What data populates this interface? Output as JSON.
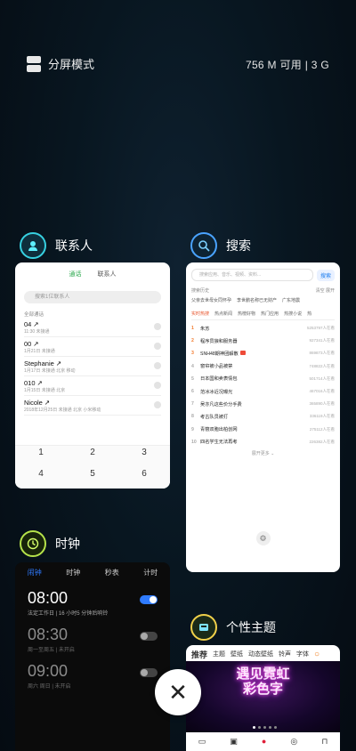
{
  "top": {
    "split_label": "分屏模式",
    "memory": "756 M 可用 | 3 G"
  },
  "contacts": {
    "name": "联系人",
    "tabs": [
      "通话",
      "联系人"
    ],
    "search_placeholder": "搜索1位联系人",
    "section": "全部通话",
    "rows": [
      {
        "name": "04 ↗",
        "detail": "11:30 未接通"
      },
      {
        "name": "00 ↗",
        "detail": "1月21日 未接通"
      },
      {
        "name": "Stephanie ↗",
        "detail": "1月17日 未接通 北京 移动"
      },
      {
        "name": "010 ↗",
        "detail": "1月15日 未接通 北京"
      },
      {
        "name": "Nicole ↗",
        "detail": "2018年12月25日 未接通 北京 小米移动"
      }
    ],
    "keys": [
      "1",
      "2",
      "3",
      "4",
      "5",
      "6"
    ]
  },
  "search": {
    "name": "搜索",
    "placeholder": "搜索应用、音乐、视频、资料...",
    "button": "搜索",
    "history_label": "搜索历史",
    "history_actions": "清空   展开",
    "history": [
      "父亲去世母女同怀孕",
      "李世鹏名称已无财产",
      "广东地震"
    ],
    "tabs": [
      "实时热搜",
      "热点新闻",
      "热榜好物",
      "热门应用",
      "热搜小说",
      "热"
    ],
    "hot": [
      {
        "rank": "1",
        "title": "朱苏",
        "heat": "5253797人在看"
      },
      {
        "rank": "2",
        "title": "程序员狼和服务器",
        "heat": "927341人在看"
      },
      {
        "rank": "3",
        "title": "SNH48期神团解散",
        "heat": "869873人在看"
      },
      {
        "rank": "4",
        "title": "窗帘被小品被禁",
        "heat": "748822人在看"
      },
      {
        "rank": "5",
        "title": "日本国和卖表情包",
        "heat": "501714人在看"
      },
      {
        "rank": "6",
        "title": "范冰冰近况曝光",
        "heat": "467016人在看"
      },
      {
        "rank": "7",
        "title": "吴亦凡这些价分手费",
        "heat": "365890人在看"
      },
      {
        "rank": "8",
        "title": "考古队员被打",
        "heat": "336119人在看"
      },
      {
        "rank": "9",
        "title": "青簪双胞出柏创网",
        "heat": "275112人在看"
      },
      {
        "rank": "10",
        "title": "四名学生无法再考",
        "heat": "226382人在看"
      }
    ],
    "more": "展开更多 ⌄"
  },
  "clock": {
    "name": "时钟",
    "tabs": [
      "闹钟",
      "时钟",
      "秒表",
      "计时"
    ],
    "alarms": [
      {
        "time": "08:00",
        "label": "法定工作日 | 16 小时5 分钟后响铃",
        "on": true
      },
      {
        "time": "08:30",
        "label": "周一至周五 | 未开启",
        "on": false
      },
      {
        "time": "09:00",
        "label": "周六 周日 | 未开启",
        "on": false
      }
    ]
  },
  "theme": {
    "name": "个性主题",
    "tabs": [
      "推荐",
      "主题",
      "壁纸",
      "动态壁纸",
      "铃声",
      "字体"
    ],
    "banner_line1": "遇见霓虹",
    "banner_line2": "彩色字"
  },
  "close": {
    "label": "✕"
  }
}
